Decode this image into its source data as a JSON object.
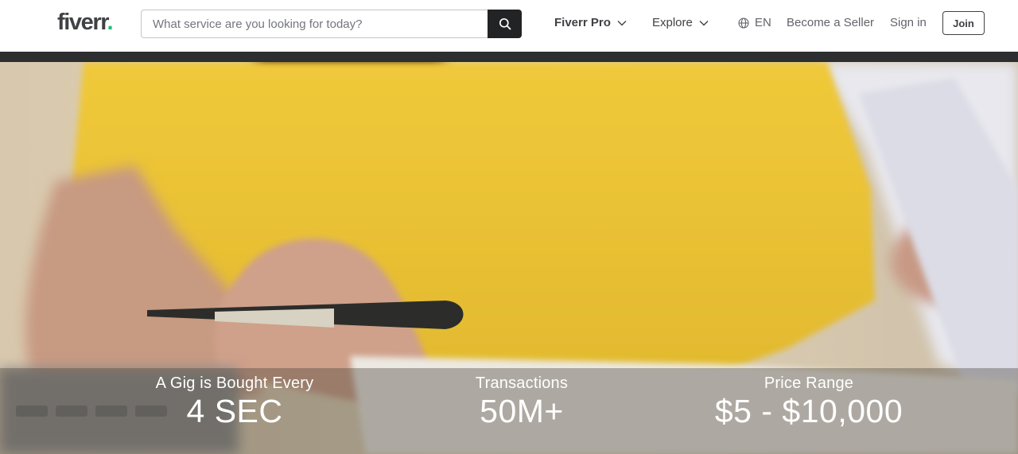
{
  "header": {
    "logo_text": "fiverr",
    "logo_dot": ".",
    "search": {
      "placeholder": "What service are you looking for today?",
      "value": ""
    },
    "nav": {
      "fiverr_pro": "Fiverr Pro",
      "explore": "Explore",
      "language": "EN",
      "become_seller": "Become a Seller",
      "sign_in": "Sign in",
      "join": "Join"
    }
  },
  "hero": {
    "stats": [
      {
        "label": "A Gig is Bought Every",
        "value": "4 SEC"
      },
      {
        "label": "Transactions",
        "value": "50M+"
      },
      {
        "label": "Price Range",
        "value": "$5 - $10,000"
      }
    ]
  },
  "colors": {
    "brand_green": "#1dbf73",
    "text_dark": "#404145",
    "search_button": "#222325"
  }
}
